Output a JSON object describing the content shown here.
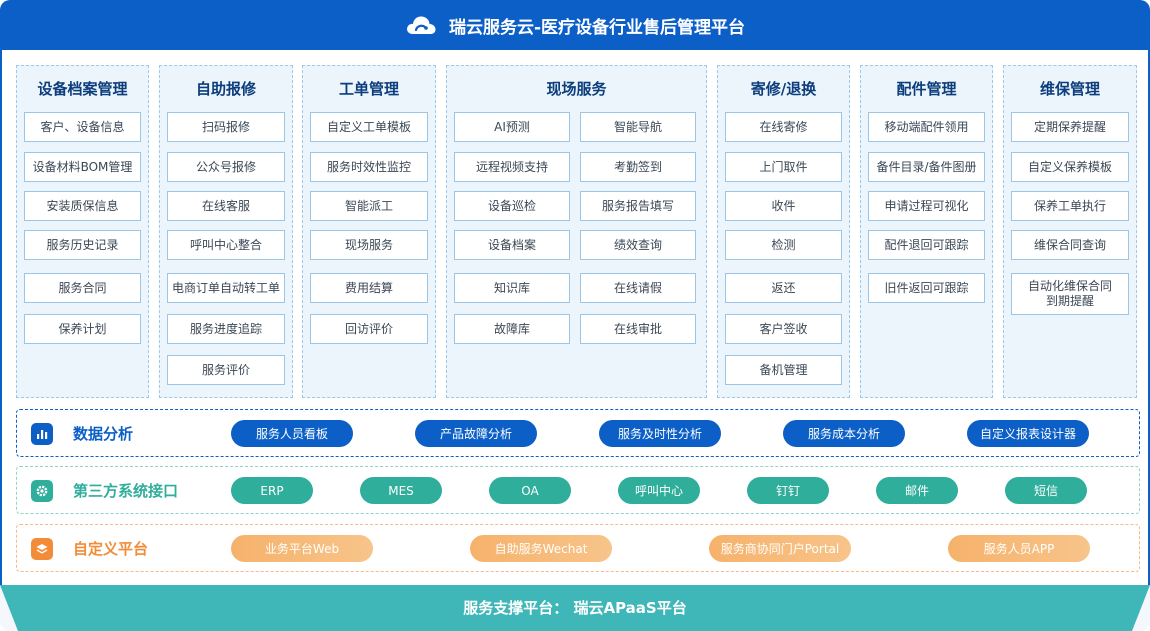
{
  "header": {
    "title": "瑞云服务云-医疗设备行业售后管理平台",
    "logo_icon": "cloud-icon"
  },
  "columns": [
    {
      "title": "设备档案管理",
      "items": [
        "客户、设备信息",
        "设备材料BOM管理",
        "安装质保信息",
        "服务历史记录",
        "服务合同",
        "保养计划"
      ]
    },
    {
      "title": "自助报修",
      "items": [
        "扫码报修",
        "公众号报修",
        "在线客服",
        "呼叫中心整合",
        "电商订单自动转工单",
        "服务进度追踪",
        "服务评价"
      ]
    },
    {
      "title": "工单管理",
      "items": [
        "自定义工单模板",
        "服务时效性监控",
        "智能派工",
        "现场服务",
        "费用结算",
        "回访评价"
      ]
    },
    {
      "title": "现场服务",
      "items": [
        "AI预测",
        "智能导航",
        "远程视频支持",
        "考勤签到",
        "设备巡检",
        "服务报告填写",
        "设备档案",
        "绩效查询",
        "知识库",
        "在线请假",
        "故障库",
        "在线审批"
      ]
    },
    {
      "title": "寄修/退换",
      "items": [
        "在线寄修",
        "上门取件",
        "收件",
        "检测",
        "返还",
        "客户签收",
        "备机管理"
      ]
    },
    {
      "title": "配件管理",
      "items": [
        "移动端配件领用",
        "备件目录/备件图册",
        "申请过程可视化",
        "配件退回可跟踪",
        "旧件返回可跟踪"
      ]
    },
    {
      "title": "维保管理",
      "items": [
        "定期保养提醒",
        "自定义保养模板",
        "保养工单执行",
        "维保合同查询",
        "自动化维保合同\n到期提醒"
      ]
    }
  ],
  "data_analysis": {
    "title": "数据分析",
    "icon": "bar-chart-icon",
    "color": "#0b5fc7",
    "items": [
      "服务人员看板",
      "产品故障分析",
      "服务及时性分析",
      "服务成本分析",
      "自定义报表设计器"
    ]
  },
  "third_party": {
    "title": "第三方系统接口",
    "icon": "gear-icon",
    "color": "#2fae9b",
    "items": [
      "ERP",
      "MES",
      "OA",
      "呼叫中心",
      "钉钉",
      "邮件",
      "短信"
    ]
  },
  "custom_platform": {
    "title": "自定义平台",
    "icon": "layers-icon",
    "color": "#f28c38",
    "items": [
      "业务平台Web",
      "自助服务Wechat",
      "服务商协同门户Portal",
      "服务人员APP"
    ]
  },
  "footer": {
    "text": "服务支撑平台： 瑞云APaaS平台",
    "color": "#3fb6b8"
  }
}
